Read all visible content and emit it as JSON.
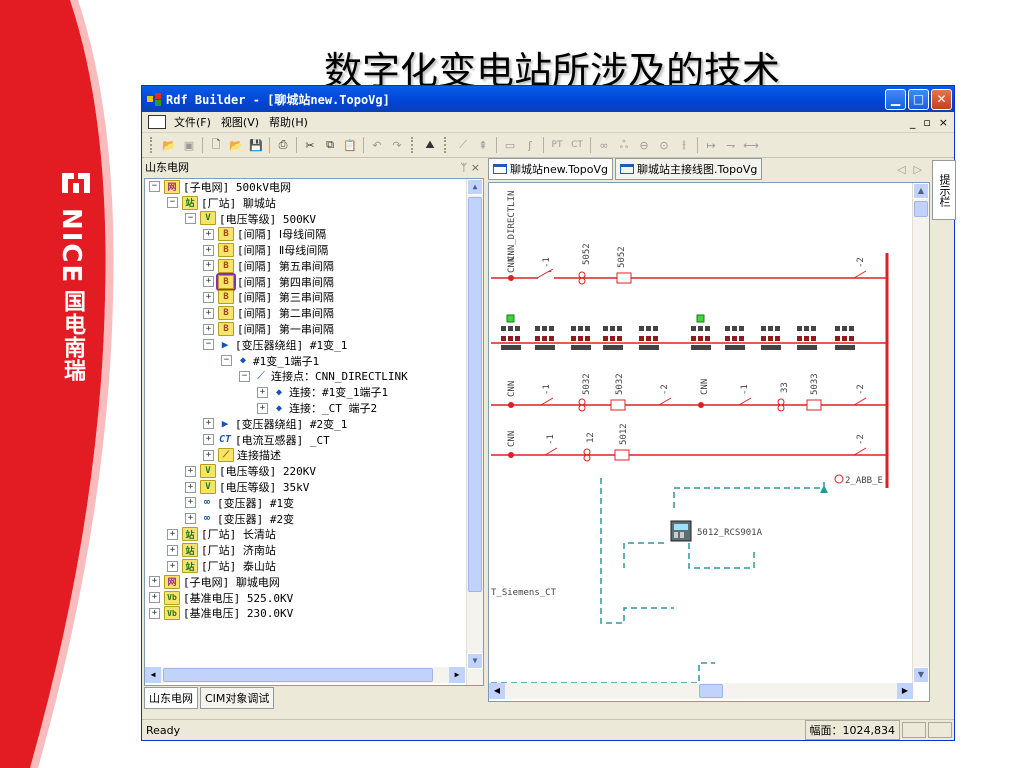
{
  "slide": {
    "title": "数字化变电站所涉及的技术"
  },
  "brand": {
    "latin": "NICE",
    "cn": "国电南瑞"
  },
  "window": {
    "title": "Rdf Builder - [聊城站new.TopoVg]"
  },
  "menu": {
    "items": [
      "文件(F)",
      "视图(V)",
      "帮助(H)"
    ],
    "mdi": [
      "_",
      "▫",
      "×"
    ]
  },
  "left_panel": {
    "title": "山东电网",
    "pin": "ᛘ ×",
    "tabs": [
      "山东电网",
      "CIM对象调试"
    ],
    "tree": [
      {
        "indent": 0,
        "exp": "−",
        "icon": "grid",
        "icon_text": "网",
        "label": "[子电网] 500kV电网"
      },
      {
        "indent": 1,
        "exp": "−",
        "icon": "station",
        "icon_text": "站",
        "label": "[厂站] 聊城站"
      },
      {
        "indent": 2,
        "exp": "−",
        "icon": "voltage",
        "icon_text": "V",
        "label": "[电压等级] 500KV"
      },
      {
        "indent": 3,
        "exp": "+",
        "icon": "bay",
        "icon_text": "B",
        "label": "[间隔] Ⅰ母线间隔"
      },
      {
        "indent": 3,
        "exp": "+",
        "icon": "bay",
        "icon_text": "B",
        "label": "[间隔] Ⅱ母线间隔"
      },
      {
        "indent": 3,
        "exp": "+",
        "icon": "bay",
        "icon_text": "B",
        "label": "[间隔] 第五串间隔"
      },
      {
        "indent": 3,
        "exp": "+",
        "icon": "bay",
        "icon_text": "B",
        "label": "[间隔] 第四串间隔",
        "selected": true
      },
      {
        "indent": 3,
        "exp": "+",
        "icon": "bay",
        "icon_text": "B",
        "label": "[间隔] 第三串间隔"
      },
      {
        "indent": 3,
        "exp": "+",
        "icon": "bay",
        "icon_text": "B",
        "label": "[间隔] 第二串间隔"
      },
      {
        "indent": 3,
        "exp": "+",
        "icon": "bay",
        "icon_text": "B",
        "label": "[间隔] 第一串间隔"
      },
      {
        "indent": 3,
        "exp": "−",
        "icon": "winding",
        "icon_text": "▶",
        "label": "[变压器绕组] #1变_1"
      },
      {
        "indent": 4,
        "exp": "−",
        "icon": "dot",
        "icon_text": "◆",
        "label": "#1变_1端子1"
      },
      {
        "indent": 5,
        "exp": "−",
        "icon": "conn",
        "icon_text": "⟋",
        "label": "连接点：CNN_DIRECTLINK"
      },
      {
        "indent": 6,
        "exp": "+",
        "icon": "dot",
        "icon_text": "◆",
        "label": "连接：#1变_1端子1"
      },
      {
        "indent": 6,
        "exp": "+",
        "icon": "dot",
        "icon_text": "◆",
        "label": "连接：_CT 端子2"
      },
      {
        "indent": 3,
        "exp": "+",
        "icon": "winding",
        "icon_text": "▶",
        "label": "[变压器绕组] #2变_1"
      },
      {
        "indent": 3,
        "exp": "+",
        "icon": "ct",
        "icon_text": "CT",
        "label": "[电流互感器] _CT"
      },
      {
        "indent": 3,
        "exp": "+",
        "icon": "link",
        "icon_text": "⟋",
        "label": "连接描述"
      },
      {
        "indent": 2,
        "exp": "+",
        "icon": "voltage",
        "icon_text": "V",
        "label": "[电压等级] 220KV"
      },
      {
        "indent": 2,
        "exp": "+",
        "icon": "voltage",
        "icon_text": "V",
        "label": "[电压等级] 35kV"
      },
      {
        "indent": 2,
        "exp": "+",
        "icon": "xfmr",
        "icon_text": "∞",
        "label": "[变压器] #1变"
      },
      {
        "indent": 2,
        "exp": "+",
        "icon": "xfmr",
        "icon_text": "∞",
        "label": "[变压器] #2变"
      },
      {
        "indent": 1,
        "exp": "+",
        "icon": "station",
        "icon_text": "站",
        "label": "[厂站] 长清站"
      },
      {
        "indent": 1,
        "exp": "+",
        "icon": "station",
        "icon_text": "站",
        "label": "[厂站] 济南站"
      },
      {
        "indent": 1,
        "exp": "+",
        "icon": "station",
        "icon_text": "站",
        "label": "[厂站] 泰山站"
      },
      {
        "indent": 0,
        "exp": "+",
        "icon": "grid",
        "icon_text": "网",
        "label": "[子电网] 聊城电网"
      },
      {
        "indent": 0,
        "exp": "+",
        "icon": "base",
        "icon_text": "Vb",
        "label": "[基准电压] 525.0KV"
      },
      {
        "indent": 0,
        "exp": "+",
        "icon": "base",
        "icon_text": "Vb",
        "label": "[基准电压] 230.0KV"
      }
    ]
  },
  "doc_tabs": [
    "聊城站new.TopoVg",
    "聊城站主接线图.TopoVg"
  ],
  "side_tab": "提示栏",
  "diagram": {
    "labels": {
      "cnn_direct": "CNN_DIRECTLIN",
      "cnn": "CNN",
      "r1_sw1": "-1",
      "r1_brk": "5052",
      "r1_ct": "5052",
      "r1_sw2": "-2",
      "r3_sw1": "-1",
      "r3_brk": "5032",
      "r3_ct": "5032",
      "r3_sw2": "-2",
      "r3_sw3": "-1",
      "r3_brk2": "33",
      "r3_ct2": "5033",
      "r3_sw4": "-2",
      "r4_sw1": "-1",
      "r4_brk": "12",
      "r4_ct": "5012",
      "r4_sw2": "-2",
      "abb": "2_ABB_E",
      "rcs": "5012_RCS901A",
      "siemens": "T_Siemens_CT"
    }
  },
  "status": {
    "ready": "Ready",
    "zoom": "幅面：1024,834"
  },
  "colors": {
    "accent_red": "#e02020",
    "dash_teal": "#2a9a9a",
    "xp_blue": "#0a5ce9"
  }
}
